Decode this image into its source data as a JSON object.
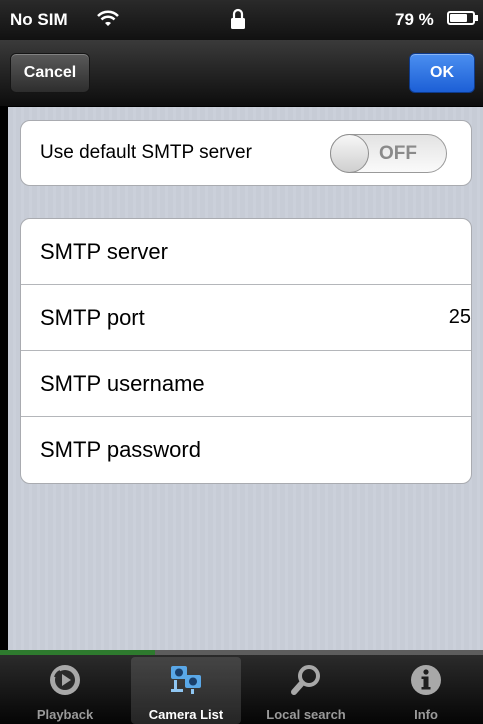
{
  "status_bar": {
    "carrier": "No SIM",
    "battery_percent_label": "79 %",
    "battery_level": 0.79
  },
  "nav": {
    "cancel_label": "Cancel",
    "ok_label": "OK"
  },
  "default_smtp": {
    "label": "Use default SMTP server",
    "toggle_state": "OFF"
  },
  "settings": {
    "rows": [
      {
        "label": "SMTP server",
        "value": ""
      },
      {
        "label": "SMTP port",
        "value": "25"
      },
      {
        "label": "SMTP username",
        "value": ""
      },
      {
        "label": "SMTP password",
        "value": ""
      }
    ]
  },
  "progress": {
    "fraction": 0.32
  },
  "tabs": [
    {
      "label": "Playback",
      "icon": "playback-icon",
      "active": false
    },
    {
      "label": "Camera List",
      "icon": "camera-list-icon",
      "active": true
    },
    {
      "label": "Local search",
      "icon": "search-icon",
      "active": false
    },
    {
      "label": "Info",
      "icon": "info-icon",
      "active": false
    }
  ],
  "colors": {
    "ok_blue": "#2b6fe0",
    "background_stripe": "#c7ccd6"
  }
}
